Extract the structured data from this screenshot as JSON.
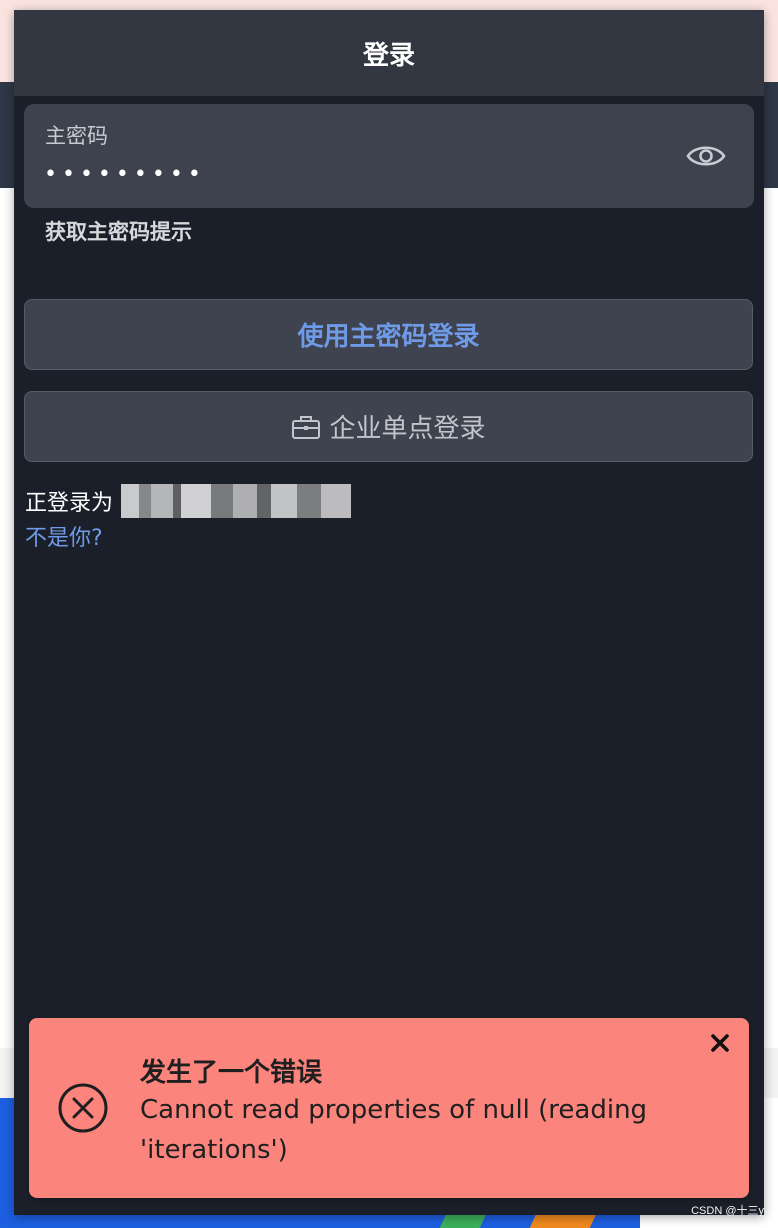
{
  "popup": {
    "title": "登录",
    "password_field": {
      "label": "主密码",
      "value": "•••••••••",
      "toggle_icon": "eye-icon"
    },
    "hint_link": "获取主密码提示",
    "primary_button": "使用主密码登录",
    "sso_button": {
      "icon": "briefcase-icon",
      "label": "企业单点登录"
    },
    "logged_in_as_label": "正登录为",
    "not_you_link": "不是你?"
  },
  "toast": {
    "icon": "error-circle-x-icon",
    "title": "发生了一个错误",
    "message": "Cannot read properties of null (reading 'iterations')",
    "close_icon": "close-icon"
  },
  "watermark": "CSDN @十三y",
  "colors": {
    "popup_bg": "#1a1f29",
    "header_bg": "#323741",
    "field_bg": "#3d424e",
    "link_blue": "#6e9ae8",
    "toast_bg": "#fb847d"
  }
}
